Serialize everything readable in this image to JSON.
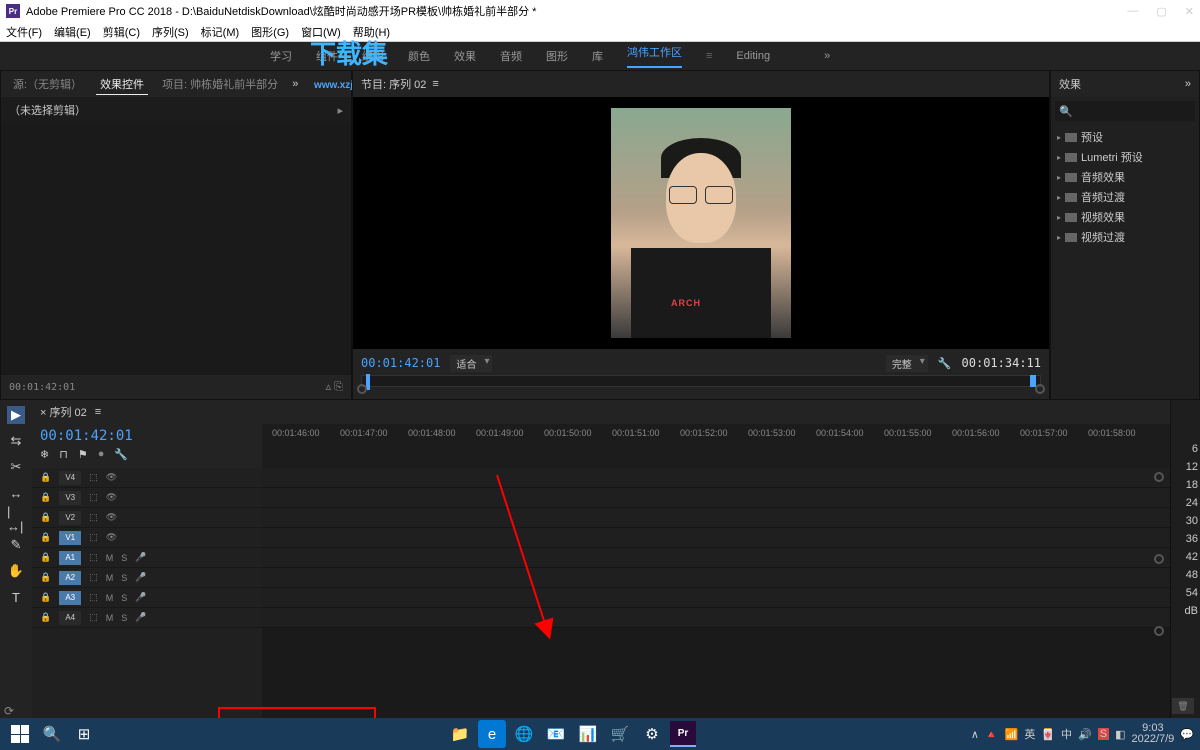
{
  "window": {
    "app_icon": "Pr",
    "title": "Adobe Premiere Pro CC 2018 - D:\\BaiduNetdiskDownload\\炫酷时尚动感开场PR模板\\帅栋婚礼前半部分 *",
    "minimize": "—",
    "maximize": "▢",
    "close": "✕"
  },
  "menu": [
    "文件(F)",
    "编辑(E)",
    "剪辑(C)",
    "序列(S)",
    "标记(M)",
    "图形(G)",
    "窗口(W)",
    "帮助(H)"
  ],
  "watermark": {
    "logo": "下载集",
    "url": "www.xzji.com"
  },
  "workspaces": {
    "items": [
      "学习",
      "组件",
      "编辑",
      "颜色",
      "效果",
      "音频",
      "图形",
      "库"
    ],
    "custom": "鸿伟工作区",
    "editing": "Editing",
    "more": "»"
  },
  "source": {
    "tabs": {
      "source": "源:（无剪辑）",
      "effect_controls": "效果控件",
      "project": "项目: 帅栋婚礼前半部分"
    },
    "no_clip": "（未选择剪辑）",
    "more": "»",
    "timecode": "00:01:42:01"
  },
  "program": {
    "header": "节目: 序列 02",
    "menu": "≡",
    "shirt": "ARCH",
    "tc_current": "00:01:42:01",
    "fit": "适合",
    "quality": "完整",
    "wrench": "🔧",
    "tc_total": "00:01:34:11",
    "buttons": {
      "mark_in": "◧",
      "in": "{",
      "out": "}",
      "goto_in": "|◀",
      "step_back": "◀|",
      "play": "▶",
      "step_fwd": "|▶",
      "goto_out": "▶|",
      "lift": "⎘",
      "extract": "⎗",
      "export": "📷",
      "compare": "▦",
      "add": "＋"
    }
  },
  "effects": {
    "title": "效果",
    "more": "»",
    "search_icon": "🔍",
    "items": [
      "预设",
      "Lumetri 预设",
      "音频效果",
      "音频过渡",
      "视频效果",
      "视频过渡"
    ]
  },
  "tools": [
    "▶",
    "⇆",
    "✂",
    "↔",
    "|↔|",
    "✎",
    "✋",
    "T"
  ],
  "timeline": {
    "seq_label": "× 序列 02",
    "menu": "≡",
    "tc": "00:01:42:01",
    "head_icons": [
      "❄",
      "⊓",
      "⚑",
      "●",
      "🔧"
    ],
    "ruler": [
      "00:01:46:00",
      "00:01:47:00",
      "00:01:48:00",
      "00:01:49:00",
      "00:01:50:00",
      "00:01:51:00",
      "00:01:52:00",
      "00:01:53:00",
      "00:01:54:00",
      "00:01:55:00",
      "00:01:56:00",
      "00:01:57:00",
      "00:01:58:00"
    ],
    "tracks": [
      {
        "name": "V4",
        "sel": false,
        "audio": false
      },
      {
        "name": "V3",
        "sel": false,
        "audio": false
      },
      {
        "name": "V2",
        "sel": false,
        "audio": false
      },
      {
        "name": "V1",
        "sel": true,
        "audio": false
      },
      {
        "name": "A1",
        "sel": true,
        "audio": true
      },
      {
        "name": "A2",
        "sel": true,
        "audio": true
      },
      {
        "name": "A3",
        "sel": true,
        "audio": true
      },
      {
        "name": "A4",
        "sel": false,
        "audio": true
      }
    ],
    "track_icons": {
      "lock": "🔒",
      "toggle": "⬚",
      "eye": "👁",
      "m": "M",
      "s": "S",
      "mic": "🎤"
    },
    "meter_marks": [
      "6",
      "12",
      "18",
      "24",
      "30",
      "36",
      "42",
      "48",
      "54",
      "dB"
    ],
    "ss": "S  S"
  },
  "taskbar": {
    "icons": [
      "🔍",
      "⊞",
      "📁",
      "e",
      "🌐",
      "📧",
      "📊",
      "🛒",
      "⚙"
    ],
    "pr": "Pr",
    "tray": [
      "∧",
      "🔺",
      "📶",
      "英",
      "🀄",
      "中",
      "🔊",
      "S",
      "◧"
    ],
    "time": "9:03",
    "date": "2022/7/9",
    "notif": "💬"
  }
}
